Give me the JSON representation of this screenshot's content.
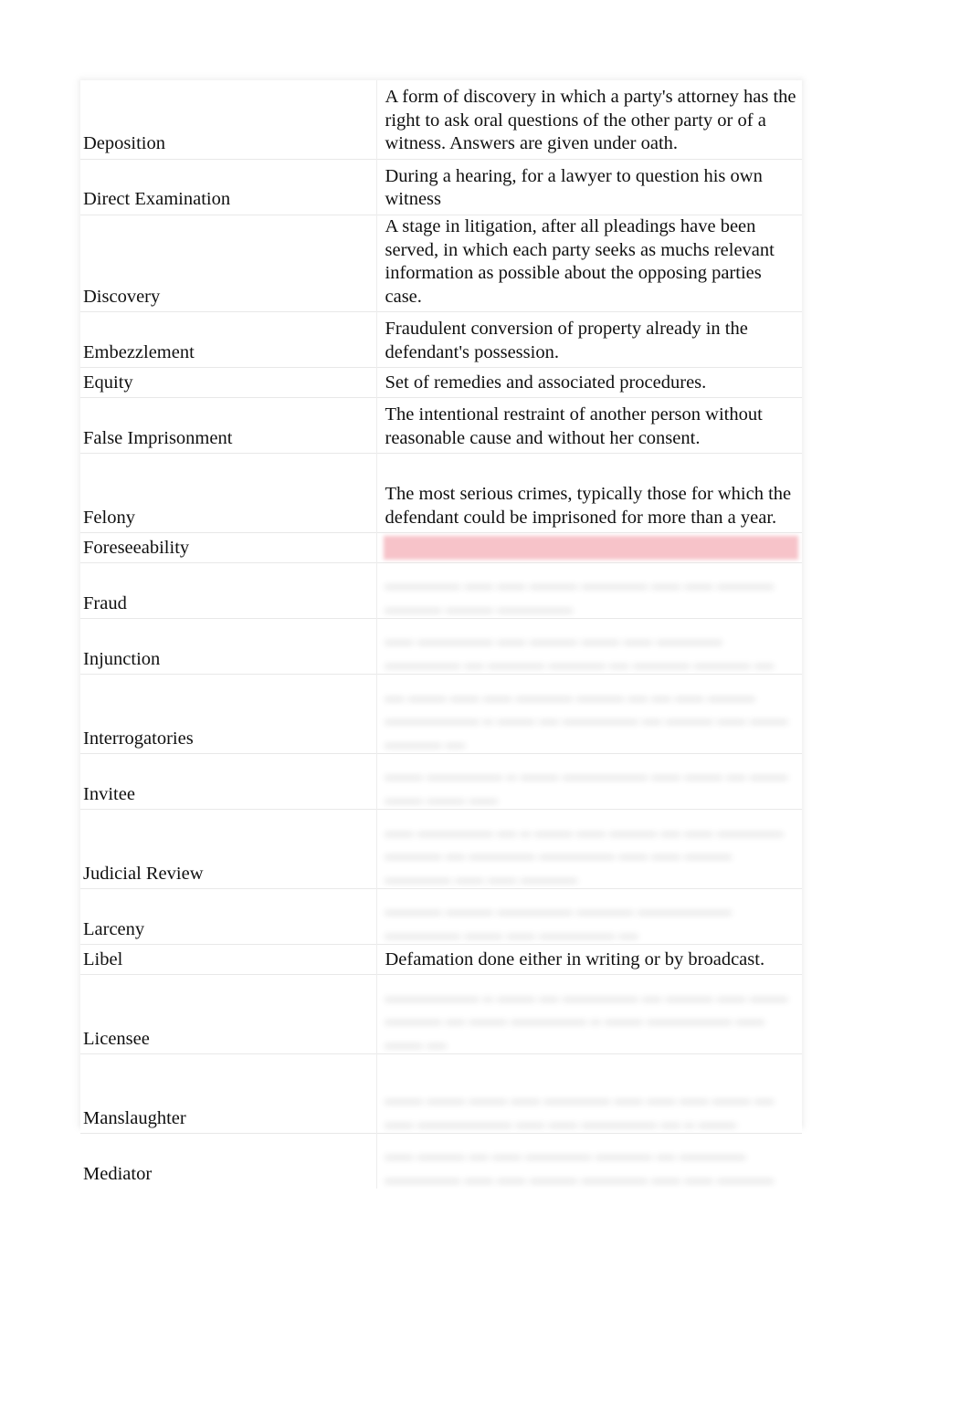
{
  "document": {
    "type": "legal-glossary-table",
    "columns": [
      "Term",
      "Definition"
    ],
    "highlight_color": "#f7c3c9",
    "page_background": "#ffffff",
    "text_color": "#101010"
  },
  "rows": [
    {
      "term": "Deposition",
      "definition": "A form of discovery in which a party's attorney has the right to ask oral questions of the other party or of a witness. Answers are given under oath.",
      "blurred": false,
      "highlighted": false,
      "height": "tall"
    },
    {
      "term": "Direct Examination",
      "definition": "During a hearing, for a lawyer to question his own witness",
      "blurred": false,
      "highlighted": false,
      "height": "mid"
    },
    {
      "term": "Discovery",
      "definition": "A stage in litigation, after all pleadings have been served, in which each party seeks as muchs relevant information as possible about the opposing parties case.",
      "blurred": false,
      "highlighted": false,
      "height": "xtall"
    },
    {
      "term": "Embezzlement",
      "definition": "Fraudulent conversion of property already in the defendant's possession.",
      "blurred": false,
      "highlighted": false,
      "height": "mid"
    },
    {
      "term": "Equity",
      "definition": "Set of remedies and associated procedures.",
      "blurred": false,
      "highlighted": false,
      "height": "short"
    },
    {
      "term": "False Imprisonment",
      "definition": "The intentional restraint of another person without reasonable cause and without her consent.",
      "blurred": false,
      "highlighted": false,
      "height": "mid"
    },
    {
      "term": "Felony",
      "definition": "The most serious crimes, typically those for which the defendant could be imprisoned for more than a year.",
      "blurred": false,
      "highlighted": false,
      "height": "tall"
    },
    {
      "term": "Foreseeability",
      "definition": "",
      "blurred": false,
      "highlighted": true,
      "height": "short"
    },
    {
      "term": "Fraud",
      "definition": "",
      "blurred": true,
      "highlighted": false,
      "height": "mid"
    },
    {
      "term": "Injunction",
      "definition": "",
      "blurred": true,
      "highlighted": false,
      "height": "mid"
    },
    {
      "term": "Interrogatories",
      "definition": "",
      "blurred": true,
      "highlighted": false,
      "height": "tall"
    },
    {
      "term": "Invitee",
      "definition": "",
      "blurred": true,
      "highlighted": false,
      "height": "mid"
    },
    {
      "term": "Judicial Review",
      "definition": "",
      "blurred": true,
      "highlighted": false,
      "height": "tall"
    },
    {
      "term": "Larceny",
      "definition": "",
      "blurred": true,
      "highlighted": false,
      "height": "mid"
    },
    {
      "term": "Libel",
      "definition": "Defamation done either in writing or by broadcast.",
      "blurred": false,
      "highlighted": false,
      "height": "short"
    },
    {
      "term": "Licensee",
      "definition": "",
      "blurred": true,
      "highlighted": false,
      "height": "tall"
    },
    {
      "term": "Manslaughter",
      "definition": "",
      "blurred": true,
      "highlighted": false,
      "height": "tall"
    },
    {
      "term": "Mediator",
      "definition": "",
      "blurred": true,
      "highlighted": false,
      "height": "mid"
    }
  ]
}
